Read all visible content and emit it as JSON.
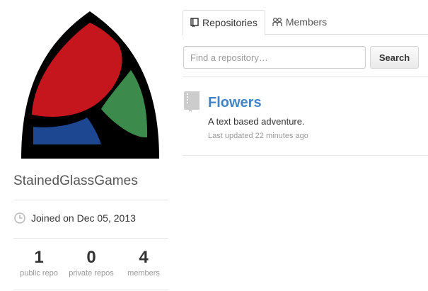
{
  "org": {
    "name": "StainedGlassGames",
    "joined": "Joined on Dec 05, 2013",
    "logo_colors": {
      "frame": "#000000",
      "red": "#c4161c",
      "green": "#3c8a4c",
      "blue": "#1d4791",
      "white": "#ffffff"
    }
  },
  "stats": [
    {
      "value": "1",
      "label": "public repo"
    },
    {
      "value": "0",
      "label": "private repos"
    },
    {
      "value": "4",
      "label": "members"
    }
  ],
  "tabs": [
    {
      "label": "Repositories",
      "icon": "repo-icon",
      "selected": true
    },
    {
      "label": "Members",
      "icon": "people-icon",
      "selected": false
    }
  ],
  "search": {
    "placeholder": "Find a repository…",
    "button_label": "Search"
  },
  "repos": [
    {
      "name": "Flowers",
      "description": "A text based adventure.",
      "updated": "Last updated 22 minutes ago",
      "icon": "book-icon"
    }
  ],
  "colors": {
    "link": "#4183c4",
    "muted": "#999999",
    "border": "#dddddd"
  }
}
